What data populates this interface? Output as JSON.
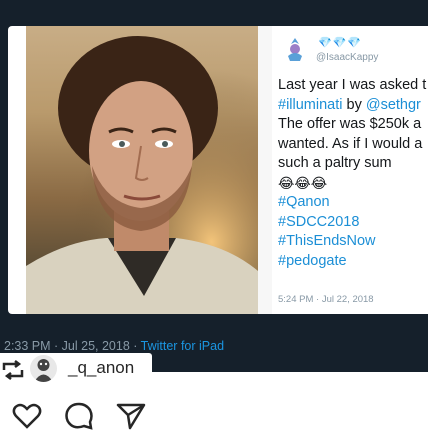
{
  "tweet": {
    "handle": "@IsaacKappy",
    "badge_glyphs": "💎💎💎",
    "text_lines": [
      "Last year I was asked t",
      "#illuminati by @sethgr",
      "The offer was $250k a",
      "wanted. As if I would a",
      "such a paltry sum"
    ],
    "emoji_line": "😂😂😂",
    "hashtags": [
      "#Qanon",
      "#SDCC2018",
      "#ThisEndsNow",
      "#pedogate"
    ],
    "timestamp": "5:24 PM · Jul 22, 2018"
  },
  "outer_tweet": {
    "timestamp": "2:33 PM · Jul 25, 2018 · ",
    "source": "Twitter for iPad"
  },
  "repost": {
    "username": "_q_anon"
  },
  "actions": {
    "icons": [
      "heart-icon",
      "comment-icon",
      "share-icon"
    ]
  },
  "colors": {
    "dark_bg": "#15202b",
    "link_blue": "#1c8fd6",
    "muted": "#8899a6"
  }
}
